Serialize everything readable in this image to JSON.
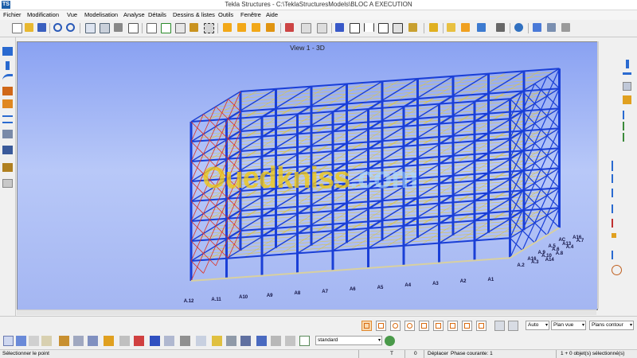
{
  "window": {
    "title": "Tekla Structures - C:\\TeklaStructuresModels\\BLOC A EXECUTION",
    "app_icon": "tekla-logo-icon"
  },
  "menu": [
    "Fichier",
    "Modification",
    "Vue",
    "Modelisation",
    "Analyse",
    "Détails",
    "Dessins & listes",
    "Outils",
    "Fenêtre",
    "Aide"
  ],
  "viewport": {
    "title": "View 1 - 3D",
    "watermark_main": "Ouedkniss",
    "watermark_suffix": ".com"
  },
  "axis_labels": [
    "A.12",
    "A.11",
    "A10",
    "A9",
    "A8",
    "A7",
    "A6",
    "A5",
    "A4",
    "A3",
    "A2",
    "A1",
    "A.2",
    "A.3",
    "A14",
    "A16",
    "A.10",
    "A.8",
    "A.9",
    "A.6",
    "A.4",
    "A.5",
    "A13",
    "A.7",
    "AC",
    "A16"
  ],
  "bottom_toolbar": {
    "dropdown_auto": "Auto",
    "dropdown_plan_vue": "Plan vue",
    "dropdown_plans_contour": "Plans contour",
    "dropdown_standard": "standard"
  },
  "status": {
    "left": "Sélectionner le point",
    "t": "T",
    "num": "0",
    "mode": "Déplacer",
    "phase": "Phase courante: 1",
    "selection": "1 + 0 objet(s) sélectionné(s)"
  },
  "colors": {
    "viewport_bg": "#9fb3f4",
    "steel_blue": "#1a3fd6",
    "deck_yellow": "#d8c450",
    "brace_red": "#e03020",
    "watermark": "#f0c814"
  },
  "icons": {
    "top_toolbar": [
      "new-icon",
      "open-icon",
      "save-icon",
      "undo-icon",
      "redo-icon",
      "copy-icon",
      "paste-icon",
      "print-icon",
      "window-icon",
      "select-icon",
      "cut-icon",
      "filter-icon",
      "cube-icon",
      "folder-icon",
      "export-icon",
      "grid-icon",
      "arrow-icon",
      "view-icon",
      "help-icon",
      "line-icon",
      "point-icon",
      "pencil-icon",
      "measure-icon",
      "plus-icon",
      "layers-icon",
      "table-icon",
      "phone-icon",
      "globe-icon",
      "forward-icon",
      "settings-icon"
    ],
    "left_toolbar": [
      "beam-icon",
      "column-icon",
      "curve-icon",
      "bent-plate-icon",
      "brace-icon",
      "slab-icon",
      "panel-icon",
      "footing-icon",
      "pad-icon",
      "component-icon"
    ],
    "right_toolbar": [
      "column-profile-icon",
      "beam-profile-icon",
      "hatch-icon",
      "plate-icon",
      "line-dim-icon",
      "diag-dim-icon",
      "node-icon",
      "cross-icon",
      "angle-icon",
      "radius-icon",
      "circle-icon"
    ]
  }
}
